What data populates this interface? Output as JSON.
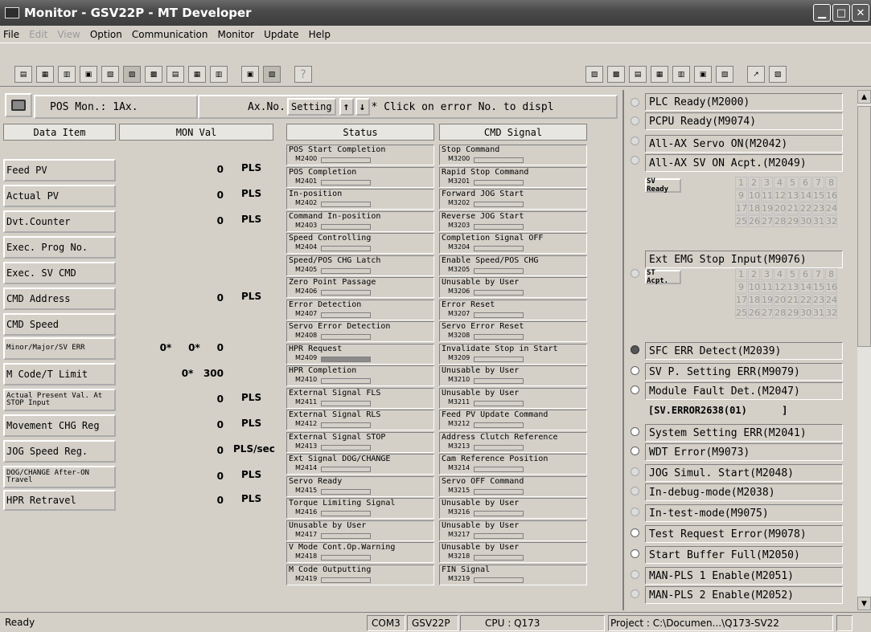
{
  "window": {
    "title": "Monitor - GSV22P - MT Developer"
  },
  "menu": [
    "File",
    "Edit",
    "View",
    "Option",
    "Communication",
    "Monitor",
    "Update",
    "Help"
  ],
  "pos": {
    "label": "POS Mon.: 1Ax.",
    "axno": "Ax.No.",
    "setting": "Setting",
    "hint": "* Click on error No. to displ"
  },
  "columns": {
    "data_item": "Data Item",
    "mon_val": "MON Val",
    "status": "Status",
    "cmd_signal": "CMD Signal"
  },
  "data_items": [
    {
      "label": "Feed PV",
      "v": "0",
      "u": "PLS"
    },
    {
      "label": "Actual PV",
      "v": "0",
      "u": "PLS"
    },
    {
      "label": "Dvt.Counter",
      "v": "0",
      "u": "PLS"
    },
    {
      "label": "Exec. Prog No.",
      "v": "",
      "u": ""
    },
    {
      "label": "Exec. SV CMD",
      "v": "",
      "u": ""
    },
    {
      "label": "CMD Address",
      "v": "0",
      "u": "PLS"
    },
    {
      "label": "CMD Speed",
      "v": "",
      "u": ""
    },
    {
      "label": "Minor/Major/SV ERR",
      "v": "0*     0*     0",
      "u": ""
    },
    {
      "label": "M Code/T Limit",
      "v": "0*   300",
      "u": ""
    },
    {
      "label": "Actual Present Val. At STOP Input",
      "v": "0",
      "u": "PLS"
    },
    {
      "label": "Movement CHG Reg",
      "v": "0",
      "u": "PLS"
    },
    {
      "label": "JOG Speed Reg.",
      "v": "0",
      "u": "PLS/sec"
    },
    {
      "label": "DOG/CHANGE After-ON Travel",
      "v": "0",
      "u": "PLS"
    },
    {
      "label": "HPR Retravel",
      "v": "0",
      "u": "PLS"
    }
  ],
  "status_signals": [
    {
      "name": "POS Start Completion",
      "addr": "M2400",
      "on": false
    },
    {
      "name": "POS Completion",
      "addr": "M2401",
      "on": false
    },
    {
      "name": "In-position",
      "addr": "M2402",
      "on": false
    },
    {
      "name": "Command In-position",
      "addr": "M2403",
      "on": false
    },
    {
      "name": "Speed Controlling",
      "addr": "M2404",
      "on": false
    },
    {
      "name": "Speed/POS CHG Latch",
      "addr": "M2405",
      "on": false
    },
    {
      "name": "Zero Point Passage",
      "addr": "M2406",
      "on": false
    },
    {
      "name": "Error Detection",
      "addr": "M2407",
      "on": false
    },
    {
      "name": "Servo Error Detection",
      "addr": "M2408",
      "on": false
    },
    {
      "name": "HPR Request",
      "addr": "M2409",
      "on": true
    },
    {
      "name": "HPR Completion",
      "addr": "M2410",
      "on": false
    },
    {
      "name": "External Signal FLS",
      "addr": "M2411",
      "on": false
    },
    {
      "name": "External Signal RLS",
      "addr": "M2412",
      "on": false
    },
    {
      "name": "External Signal STOP",
      "addr": "M2413",
      "on": false
    },
    {
      "name": "Ext Signal DOG/CHANGE",
      "addr": "M2414",
      "on": false
    },
    {
      "name": "Servo Ready",
      "addr": "M2415",
      "on": false
    },
    {
      "name": "Torque Limiting Signal",
      "addr": "M2416",
      "on": false
    },
    {
      "name": "Unusable by User",
      "addr": "M2417",
      "on": false
    },
    {
      "name": "V Mode Cont.Op.Warning",
      "addr": "M2418",
      "on": false
    },
    {
      "name": "M Code Outputting",
      "addr": "M2419",
      "on": false
    }
  ],
  "cmd_signals": [
    {
      "name": "Stop Command",
      "addr": "M3200",
      "on": false
    },
    {
      "name": "Rapid Stop Command",
      "addr": "M3201",
      "on": false
    },
    {
      "name": "Forward JOG Start",
      "addr": "M3202",
      "on": false
    },
    {
      "name": "Reverse JOG Start",
      "addr": "M3203",
      "on": false
    },
    {
      "name": "Completion Signal OFF",
      "addr": "M3204",
      "on": false
    },
    {
      "name": "Enable Speed/POS CHG",
      "addr": "M3205",
      "on": false
    },
    {
      "name": "Unusable by User",
      "addr": "M3206",
      "on": false
    },
    {
      "name": "Error Reset",
      "addr": "M3207",
      "on": false
    },
    {
      "name": "Servo Error Reset",
      "addr": "M3208",
      "on": false
    },
    {
      "name": "Invalidate Stop in Start",
      "addr": "M3209",
      "on": false
    },
    {
      "name": "Unusable by User",
      "addr": "M3210",
      "on": false
    },
    {
      "name": "Unusable by User",
      "addr": "M3211",
      "on": false
    },
    {
      "name": "Feed PV Update Command",
      "addr": "M3212",
      "on": false
    },
    {
      "name": "Address Clutch Reference",
      "addr": "M3213",
      "on": false
    },
    {
      "name": "Cam Reference Position",
      "addr": "M3214",
      "on": false
    },
    {
      "name": "Servo OFF Command",
      "addr": "M3215",
      "on": false
    },
    {
      "name": "Unusable by User",
      "addr": "M3216",
      "on": false
    },
    {
      "name": "Unusable by User",
      "addr": "M3217",
      "on": false
    },
    {
      "name": "Unusable by User",
      "addr": "M3218",
      "on": false
    },
    {
      "name": "FIN Signal",
      "addr": "M3219",
      "on": false
    }
  ],
  "right": {
    "plc_ready": "PLC Ready(M2000)",
    "pcpu_ready": "PCPU Ready(M9074)",
    "allax_servo": "All-AX Servo ON(M2042)",
    "allax_sv_acpt": "All-AX SV ON Acpt.(M2049)",
    "sv_ready_label": "SV Ready",
    "ext_emg": "Ext EMG Stop Input(M9076)",
    "st_acpt_label": "ST Acpt.",
    "grid_numbers": [
      "1",
      "2",
      "3",
      "4",
      "5",
      "6",
      "7",
      "8",
      "9",
      "10",
      "11",
      "12",
      "13",
      "14",
      "15",
      "16",
      "17",
      "18",
      "19",
      "20",
      "21",
      "22",
      "23",
      "24",
      "25",
      "26",
      "27",
      "28",
      "29",
      "30",
      "31",
      "32"
    ],
    "sfc_err": "SFC ERR Detect(M2039)",
    "svp_err": "SV P. Setting ERR(M9079)",
    "module_fault": "Module Fault Det.(M2047)",
    "sv_error": "[SV.ERROR2638(01)      ]",
    "sys_setting": "System Setting ERR(M2041)",
    "wdt": "WDT Error(M9073)",
    "jog_simul": "JOG Simul. Start(M2048)",
    "debug_mode": "In-debug-mode(M2038)",
    "test_mode": "In-test-mode(M9075)",
    "test_req": "Test Request Error(M9078)",
    "start_buf": "Start Buffer Full(M2050)",
    "man_pls1": "MAN-PLS 1 Enable(M2051)",
    "man_pls2": "MAN-PLS 2 Enable(M2052)"
  },
  "status": {
    "ready": "Ready",
    "com": "COM3",
    "model": "GSV22P",
    "cpu": "CPU : Q173",
    "project": "Project : C:\\Documen...\\Q173-SV22"
  }
}
